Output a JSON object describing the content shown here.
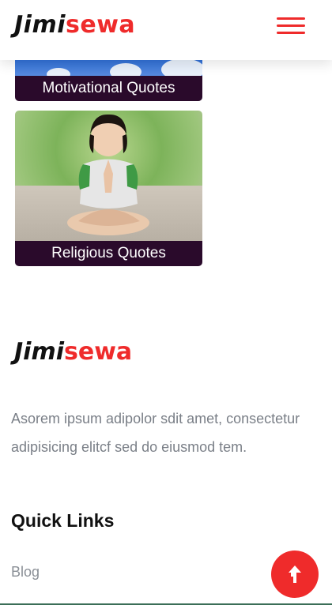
{
  "brand": {
    "name_part1": "Jimi",
    "name_part2": "sewa",
    "accent": "#ef2b2b"
  },
  "header": {
    "menu_icon": "hamburger-icon"
  },
  "categories": [
    {
      "label": "Motivational Quotes"
    },
    {
      "label": "Religious Quotes"
    }
  ],
  "footer": {
    "about": "Asorem ipsum adipolor sdit amet, consectetur adipisicing elitcf sed do eiusmod tem.",
    "quick_links_title": "Quick Links",
    "links": [
      {
        "label": "Blog"
      }
    ]
  },
  "back_to_top": {
    "icon": "arrow-up-icon"
  },
  "colors": {
    "caption_bg": "#2a0a2b",
    "text_muted": "#7a7f87"
  }
}
